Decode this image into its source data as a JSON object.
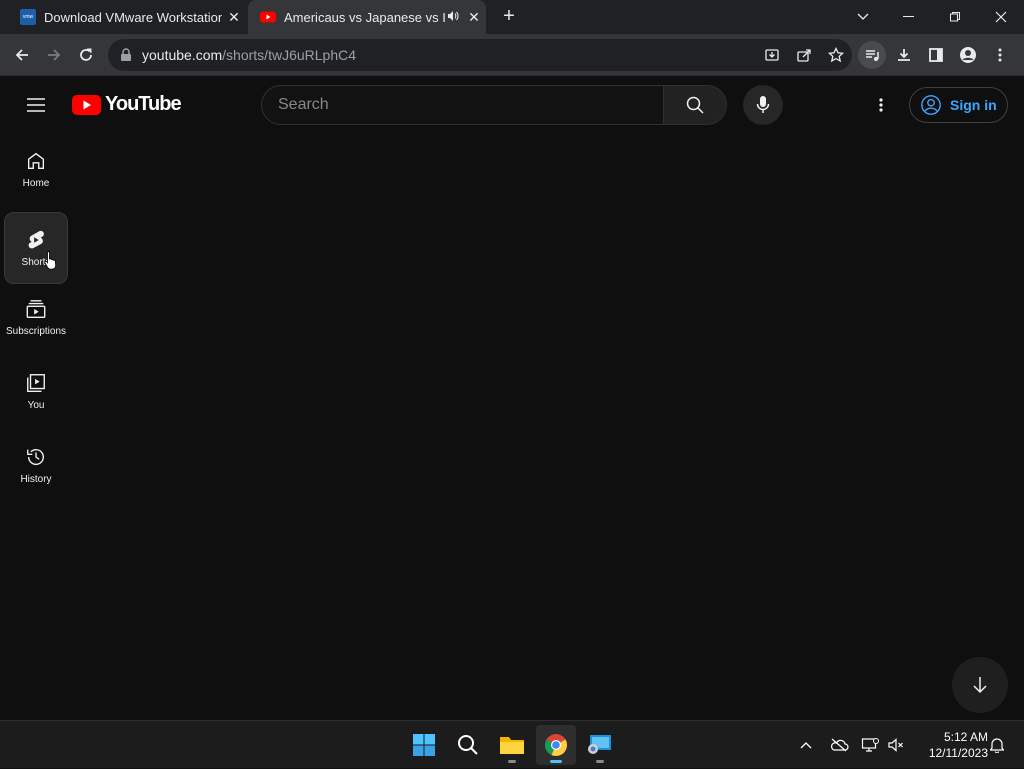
{
  "browser": {
    "tabs": [
      {
        "title": "Download VMware Workstation",
        "favicon": "vmware-icon",
        "favicon_text": "vmw"
      },
      {
        "title": "Americaus vs Japanese vs Indi",
        "favicon": "youtube-icon",
        "audio": true
      }
    ],
    "url_host": "youtube.com",
    "url_path": "/shorts/twJ6uRLphC4"
  },
  "youtube": {
    "logo_text": "YouTube",
    "search_placeholder": "Search",
    "signin_label": "Sign in",
    "guide": [
      {
        "label": "Home",
        "icon": "home-icon"
      },
      {
        "label": "Shorts",
        "icon": "shorts-icon",
        "selected": true
      },
      {
        "label": "Subscriptions",
        "icon": "subscriptions-icon"
      },
      {
        "label": "You",
        "icon": "you-icon"
      },
      {
        "label": "History",
        "icon": "history-icon"
      }
    ]
  },
  "taskbar": {
    "time": "5:12 AM",
    "date": "12/11/2023"
  },
  "colors": {
    "background": "#0f0f0f",
    "accent_link": "#3ea6ff",
    "youtube_red": "#ff0000"
  }
}
